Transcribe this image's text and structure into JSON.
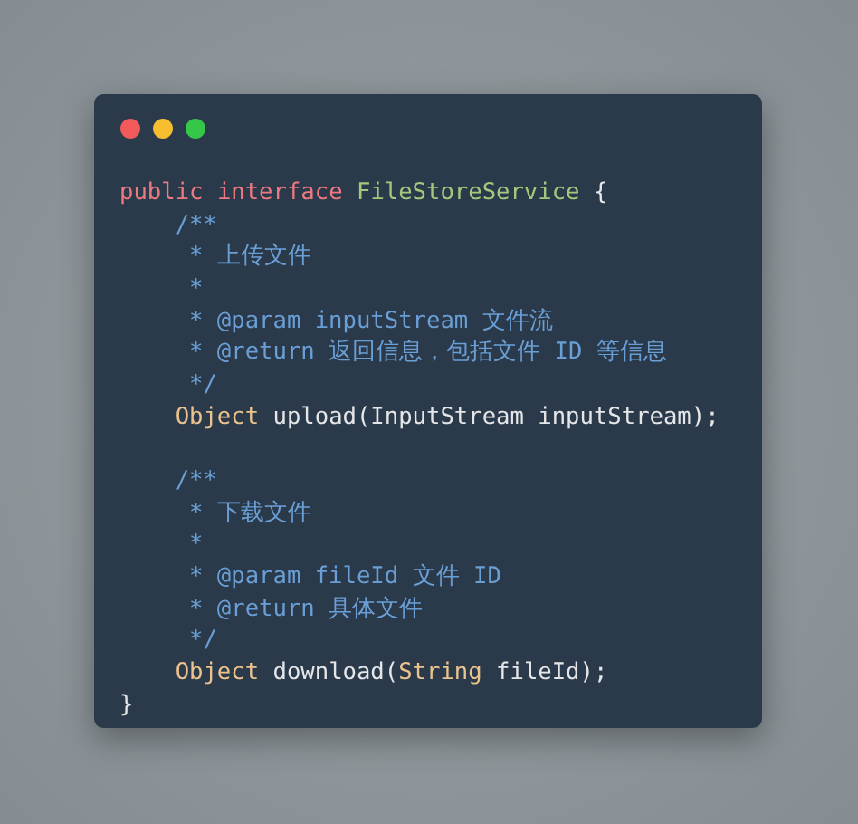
{
  "code_window": {
    "lines": [
      {
        "kind": "code",
        "indented": false,
        "tokens": [
          {
            "kind": "keyword",
            "text": "public "
          },
          {
            "kind": "keyword",
            "text": "interface "
          },
          {
            "kind": "name",
            "text": "FileStoreService"
          },
          {
            "kind": "plain",
            "text": " {"
          }
        ]
      },
      {
        "kind": "code",
        "indented": true,
        "tokens": [
          {
            "kind": "comment",
            "text": "/**"
          }
        ]
      },
      {
        "kind": "code",
        "indented": true,
        "tokens": [
          {
            "kind": "comment",
            "text": " * 上传文件"
          }
        ]
      },
      {
        "kind": "code",
        "indented": true,
        "tokens": [
          {
            "kind": "comment",
            "text": " *"
          }
        ]
      },
      {
        "kind": "code",
        "indented": true,
        "tokens": [
          {
            "kind": "comment",
            "text": " * @param inputStream 文件流"
          }
        ]
      },
      {
        "kind": "code",
        "indented": true,
        "tokens": [
          {
            "kind": "comment",
            "text": " * @return 返回信息，包括文件 ID 等信息"
          }
        ]
      },
      {
        "kind": "code",
        "indented": true,
        "tokens": [
          {
            "kind": "comment",
            "text": " */"
          }
        ]
      },
      {
        "kind": "code",
        "indented": true,
        "tokens": [
          {
            "kind": "type",
            "text": "Object"
          },
          {
            "kind": "plain",
            "text": " upload(InputStream inputStream);"
          }
        ]
      },
      {
        "kind": "blank"
      },
      {
        "kind": "code",
        "indented": true,
        "tokens": [
          {
            "kind": "comment",
            "text": "/**"
          }
        ]
      },
      {
        "kind": "code",
        "indented": true,
        "tokens": [
          {
            "kind": "comment",
            "text": " * 下载文件"
          }
        ]
      },
      {
        "kind": "code",
        "indented": true,
        "tokens": [
          {
            "kind": "comment",
            "text": " *"
          }
        ]
      },
      {
        "kind": "code",
        "indented": true,
        "tokens": [
          {
            "kind": "comment",
            "text": " * @param fileId 文件 ID"
          }
        ]
      },
      {
        "kind": "code",
        "indented": true,
        "tokens": [
          {
            "kind": "comment",
            "text": " * @return 具体文件"
          }
        ]
      },
      {
        "kind": "code",
        "indented": true,
        "tokens": [
          {
            "kind": "comment",
            "text": " */"
          }
        ]
      },
      {
        "kind": "code",
        "indented": true,
        "tokens": [
          {
            "kind": "type",
            "text": "Object"
          },
          {
            "kind": "plain",
            "text": " download("
          },
          {
            "kind": "type",
            "text": "String"
          },
          {
            "kind": "plain",
            "text": " fileId);"
          }
        ]
      },
      {
        "kind": "code",
        "indented": false,
        "tokens": [
          {
            "kind": "plain",
            "text": "}"
          }
        ]
      }
    ]
  }
}
